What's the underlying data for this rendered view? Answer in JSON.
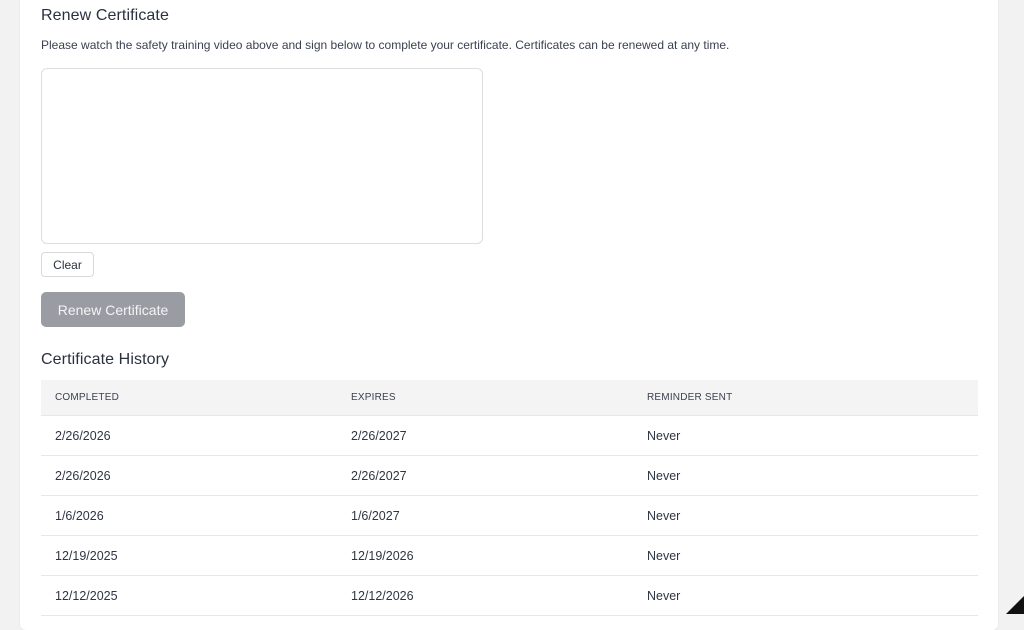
{
  "renew": {
    "title": "Renew Certificate",
    "instructions": "Please watch the safety training video above and sign below to complete your certificate. Certificates can be renewed at any time.",
    "clear_label": "Clear",
    "renew_label": "Renew Certificate"
  },
  "history": {
    "title": "Certificate History",
    "columns": [
      "COMPLETED",
      "EXPIRES",
      "REMINDER SENT"
    ],
    "rows": [
      {
        "completed": "2/26/2026",
        "expires": "2/26/2027",
        "reminder": "Never"
      },
      {
        "completed": "2/26/2026",
        "expires": "2/26/2027",
        "reminder": "Never"
      },
      {
        "completed": "1/6/2026",
        "expires": "1/6/2027",
        "reminder": "Never"
      },
      {
        "completed": "12/19/2025",
        "expires": "12/19/2026",
        "reminder": "Never"
      },
      {
        "completed": "12/12/2025",
        "expires": "12/12/2026",
        "reminder": "Never"
      }
    ]
  },
  "colors": {
    "page_background": "#f2f2f3",
    "card_background": "#ffffff",
    "disabled_button": "#9a9ca3",
    "table_header": "#f4f4f5"
  }
}
